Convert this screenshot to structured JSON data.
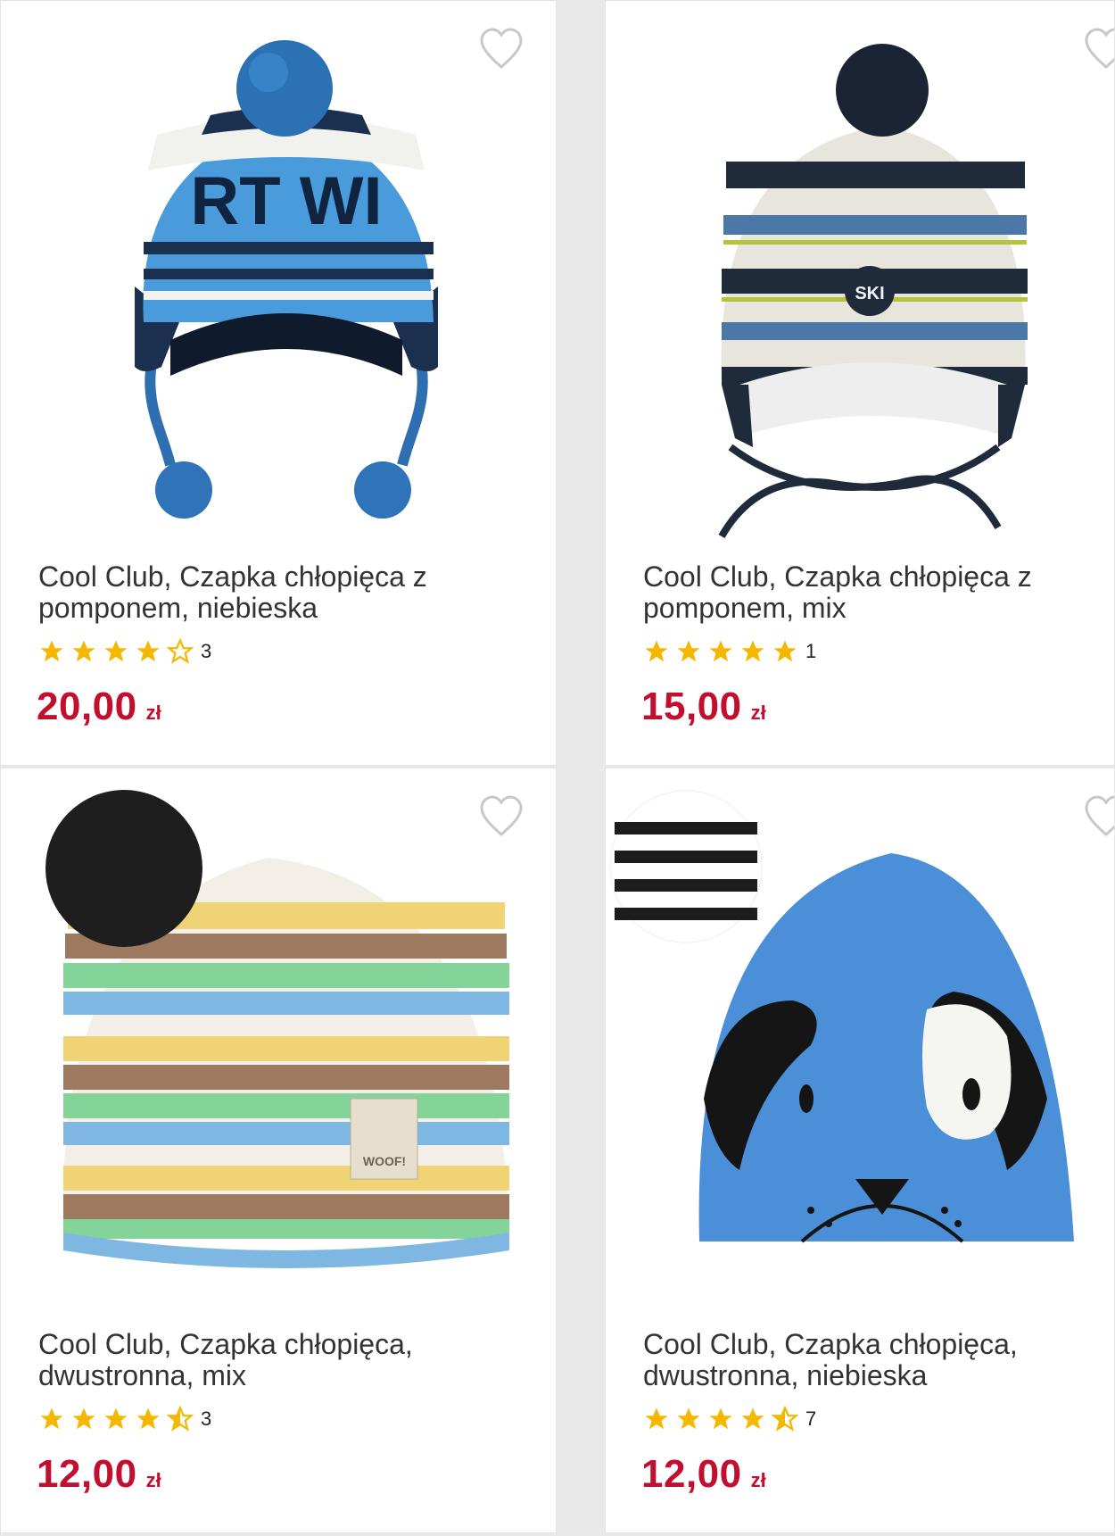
{
  "products": [
    {
      "title": "Cool Club, Czapka chłopięca z pomponem, niebieska",
      "rating": 4,
      "rating_count": "3",
      "price": "20,00",
      "currency": "zł",
      "hat_text": "RT WI"
    },
    {
      "title": "Cool Club, Czapka chłopięca z pomponem, mix",
      "rating": 5,
      "rating_count": "1",
      "price": "15,00",
      "currency": "zł",
      "badge_text": "SKI"
    },
    {
      "title": "Cool Club, Czapka chłopięca, dwustronna, mix",
      "rating": 4.5,
      "rating_count": "3",
      "price": "12,00",
      "currency": "zł",
      "label_text": "WOOF!"
    },
    {
      "title": "Cool Club, Czapka chłopięca, dwustronna, niebieska",
      "rating": 4.5,
      "rating_count": "7",
      "price": "12,00",
      "currency": "zł"
    }
  ],
  "colors": {
    "price": "#c20f2f",
    "star": "#f5b800",
    "heart": "#c8c8c8"
  },
  "icons": [
    "heart-outline-icon",
    "star-icon"
  ]
}
